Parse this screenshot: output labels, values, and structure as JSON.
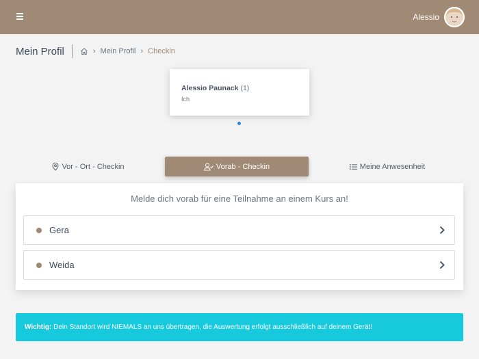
{
  "header": {
    "user_name": "Alessio",
    "menu_icon": "hamburger-icon"
  },
  "page": {
    "title": "Mein Profil",
    "breadcrumb": [
      "Mein Profil",
      "Checkin"
    ]
  },
  "member_card": {
    "name": "Alessio Paunack",
    "count": "(1)",
    "role": "Ich"
  },
  "tabs": [
    {
      "label": "Vor - Ort - Checkin",
      "icon": "map-pin-icon",
      "active": false
    },
    {
      "label": "Vorab - Checkin",
      "icon": "user-check-icon",
      "active": true
    },
    {
      "label": "Meine Anwesenheit",
      "icon": "list-icon",
      "active": false
    }
  ],
  "panel": {
    "title": "Melde dich vorab für eine Teilnahme an einem Kurs an!",
    "courses": [
      "Gera",
      "Weida"
    ]
  },
  "alert": {
    "label": "Wichtig:",
    "text": "Dein Standort wird NIEMALS an uns übertragen, die Auswertung erfolgt ausschließlich auf deinem Gerät!"
  },
  "colors": {
    "brand": "#a08a75",
    "info": "#17c9dc",
    "pager_active": "#2f86d6"
  }
}
